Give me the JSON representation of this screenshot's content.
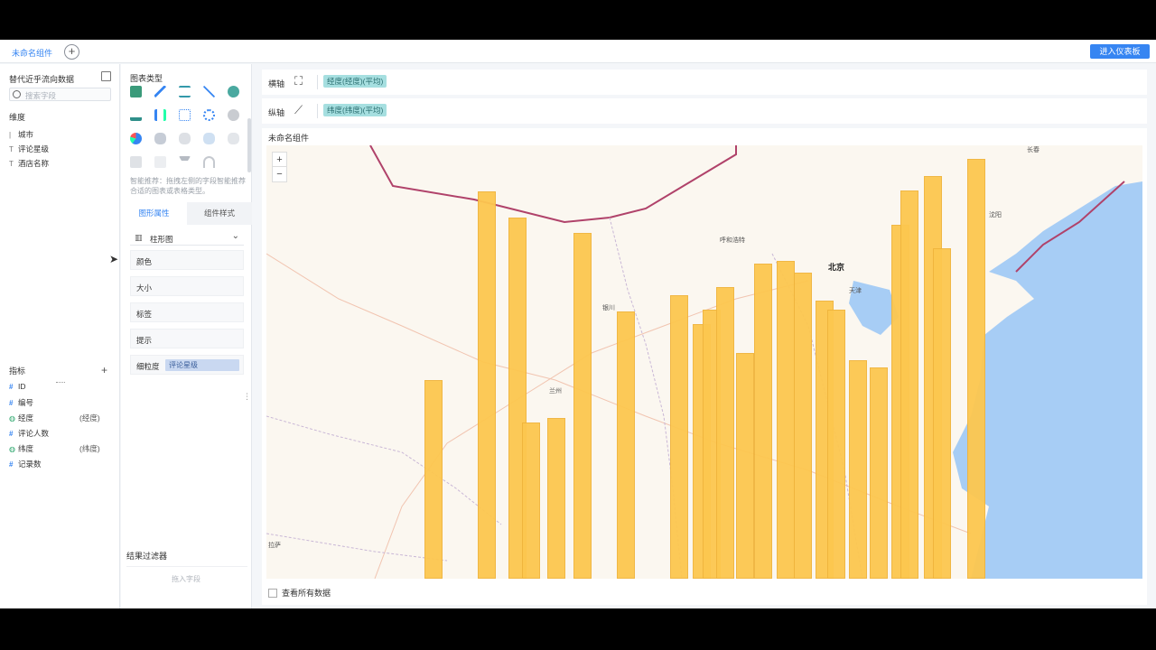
{
  "topbar": {
    "tab_label": "未命名组件",
    "add_tab_icon": "plus-circle-icon",
    "dashboard_button": "进入仪表板",
    "accent_color": "#3685f2"
  },
  "left_panel": {
    "dataset_name": "替代近乎流向数据",
    "search_placeholder": "搜索字段",
    "dimension_title": "维度",
    "dimensions": [
      {
        "icon": "T",
        "label": "城市"
      },
      {
        "icon": "T",
        "label": "评论星级"
      },
      {
        "icon": "T",
        "label": "酒店名称"
      }
    ],
    "measure_title": "指标",
    "measures": [
      {
        "icon": "#",
        "label": "ID",
        "tag": ""
      },
      {
        "icon": "#",
        "label": "编号",
        "tag": ""
      },
      {
        "icon": "globe",
        "label": "经度",
        "tag": "(经度)"
      },
      {
        "icon": "#",
        "label": "评论人数",
        "tag": ""
      },
      {
        "icon": "globe",
        "label": "纬度",
        "tag": "(纬度)"
      },
      {
        "icon": "#",
        "label": "记录数",
        "tag": ""
      }
    ]
  },
  "middle_panel": {
    "chart_type_title": "图表类型",
    "smart_tip": "智能推荐：拖拽左侧的字段智能推荐合适的图表或表格类型。",
    "tabs": {
      "shape": "图形属性",
      "component": "组件样式"
    },
    "chart_type_selected": "柱形图",
    "properties": [
      "颜色",
      "大小",
      "标签",
      "提示"
    ],
    "granularity": {
      "label": "细粒度",
      "chip": "评论星级"
    },
    "filter_title": "结果过滤器",
    "filter_placeholder": "拖入字段"
  },
  "axes": {
    "x_label": "横轴",
    "x_pill": "经度(经度)(平均)",
    "y_label": "纵轴",
    "y_pill": "纬度(纬度)(平均)"
  },
  "canvas": {
    "title": "未命名组件",
    "zoom_in": "+",
    "zoom_out": "−",
    "show_all_label": "查看所有数据",
    "bar_color": "#fdc74f",
    "sea_color": "#a7cdf5"
  },
  "map_labels": {
    "beijing": "北京",
    "tianjin": "天津",
    "hohhot": "呼和浩特",
    "yinchuan": "银川",
    "lanzhou": "兰州",
    "changchun": "长春",
    "shenyang": "沈阳",
    "lhasa": "拉萨"
  }
}
